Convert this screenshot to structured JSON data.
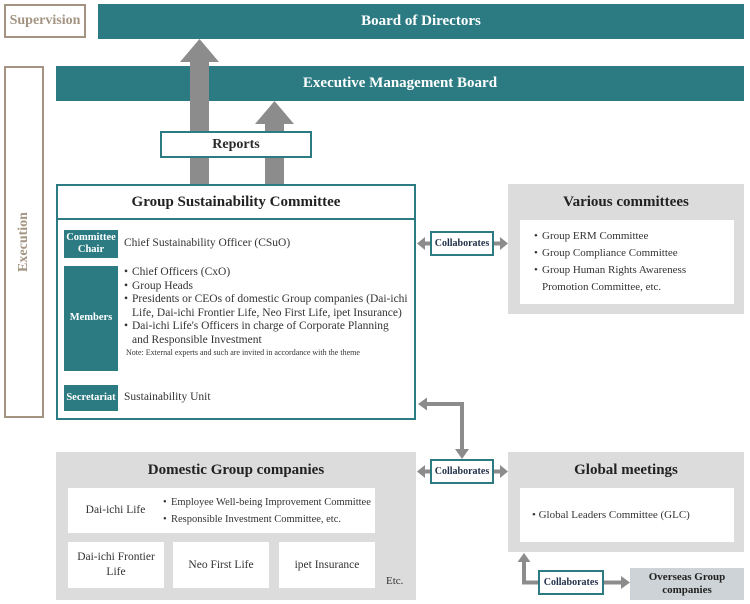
{
  "side_labels": {
    "supervision": "Supervision",
    "execution": "Execution"
  },
  "board_of_directors": "Board of Directors",
  "executive_management_board": "Executive Management Board",
  "reports_label": "Reports",
  "group_sustainability_committee": {
    "title": "Group Sustainability Committee",
    "chair": {
      "tag": "Committee Chair",
      "text": "Chief Sustainability Officer (CSuO)"
    },
    "members": {
      "tag": "Members",
      "items": [
        "Chief Officers (CxO)",
        "Group Heads",
        "Presidents or CEOs of domestic Group companies (Dai-ichi Life, Dai-ichi Frontier Life, Neo First Life, ipet Insurance)",
        "Dai-ichi Life's Officers in charge of Corporate Planning and Responsible Investment"
      ],
      "note": "Note: External experts and such are invited in accordance with the theme"
    },
    "secretariat": {
      "tag": "Secretariat",
      "text": "Sustainability Unit"
    }
  },
  "collaborates_label": "Collaborates",
  "various_committees": {
    "title": "Various committees",
    "items": [
      "Group ERM Committee",
      "Group Compliance Committee",
      "Group Human Rights Awareness Promotion Committee, etc."
    ]
  },
  "domestic_group_companies": {
    "title": "Domestic Group companies",
    "dai_ichi_life": {
      "name": "Dai-ichi Life",
      "items": [
        "Employee Well-being Improvement Committee",
        "Responsible Investment Committee, etc."
      ]
    },
    "others": [
      "Dai-ichi Frontier Life",
      "Neo First Life",
      "ipet Insurance"
    ],
    "etc": "Etc."
  },
  "global_meetings": {
    "title": "Global meetings",
    "items": [
      "Global Leaders Committee (GLC)"
    ]
  },
  "overseas_group_companies": "Overseas Group companies",
  "colors": {
    "teal": "#2c7b82",
    "side_label": "#a39482",
    "arrow_gray": "#8c8c8c",
    "panel_gray": "#dcdcdc"
  }
}
